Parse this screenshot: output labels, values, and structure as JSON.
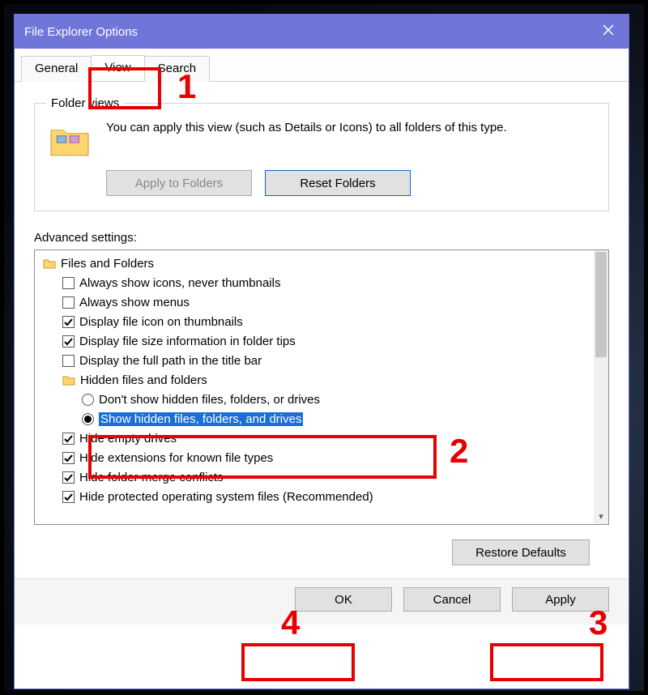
{
  "window": {
    "title": "File Explorer Options"
  },
  "tabs": {
    "general": "General",
    "view": "View",
    "search": "Search"
  },
  "folder_views": {
    "legend": "Folder views",
    "text": "You can apply this view (such as Details or Icons) to all folders of this type.",
    "apply": "Apply to Folders",
    "reset": "Reset Folders"
  },
  "advanced_label": "Advanced settings:",
  "tree": {
    "group1": "Files and Folders",
    "i1": "Always show icons, never thumbnails",
    "i2": "Always show menus",
    "i3": "Display file icon on thumbnails",
    "i4": "Display file size information in folder tips",
    "i5": "Display the full path in the title bar",
    "sub": "Hidden files and folders",
    "r1": "Don't show hidden files, folders, or drives",
    "r2": "Show hidden files, folders, and drives",
    "i6": "Hide empty drives",
    "i7": "Hide extensions for known file types",
    "i8": "Hide folder merge conflicts",
    "i9": "Hide protected operating system files (Recommended)"
  },
  "restore": "Restore Defaults",
  "dlg": {
    "ok": "OK",
    "cancel": "Cancel",
    "apply": "Apply"
  },
  "annotations": {
    "n1": "1",
    "n2": "2",
    "n3": "3",
    "n4": "4"
  }
}
